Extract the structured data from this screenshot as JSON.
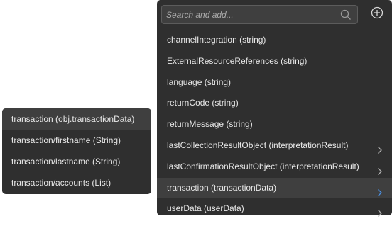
{
  "search": {
    "placeholder": "Search and add...",
    "value": "",
    "icon": "search-icon"
  },
  "add_button": {
    "icon": "plus-circle-icon"
  },
  "menu": {
    "items": [
      {
        "label": "channelIntegration (string)",
        "has_submenu": false,
        "selected": false
      },
      {
        "label": "ExternalResourceReferences (string)",
        "has_submenu": false,
        "selected": false
      },
      {
        "label": "language (string)",
        "has_submenu": false,
        "selected": false
      },
      {
        "label": "returnCode (string)",
        "has_submenu": false,
        "selected": false
      },
      {
        "label": "returnMessage (string)",
        "has_submenu": false,
        "selected": false
      },
      {
        "label": "lastCollectionResultObject (interpretationResult)",
        "has_submenu": true,
        "selected": false
      },
      {
        "label": "lastConfirmationResultObject (interpretationResult)",
        "has_submenu": true,
        "selected": false
      },
      {
        "label": "transaction (transactionData)",
        "has_submenu": true,
        "selected": true
      },
      {
        "label": "userData (userData)",
        "has_submenu": true,
        "selected": false
      }
    ]
  },
  "submenu": {
    "items": [
      {
        "label": "transaction (obj.transactionData)",
        "highlight": true
      },
      {
        "label": "transaction/firstname (String)",
        "highlight": false
      },
      {
        "label": "transaction/lastname (String)",
        "highlight": false
      },
      {
        "label": "transaction/accounts (List)",
        "highlight": false
      }
    ]
  },
  "colors": {
    "panel_bg": "#2f2f2f",
    "selected_bg": "#3f3f3f",
    "text": "#e8e8e8",
    "chevron": "#b0b0b0",
    "chevron_active": "#4a90e2"
  }
}
